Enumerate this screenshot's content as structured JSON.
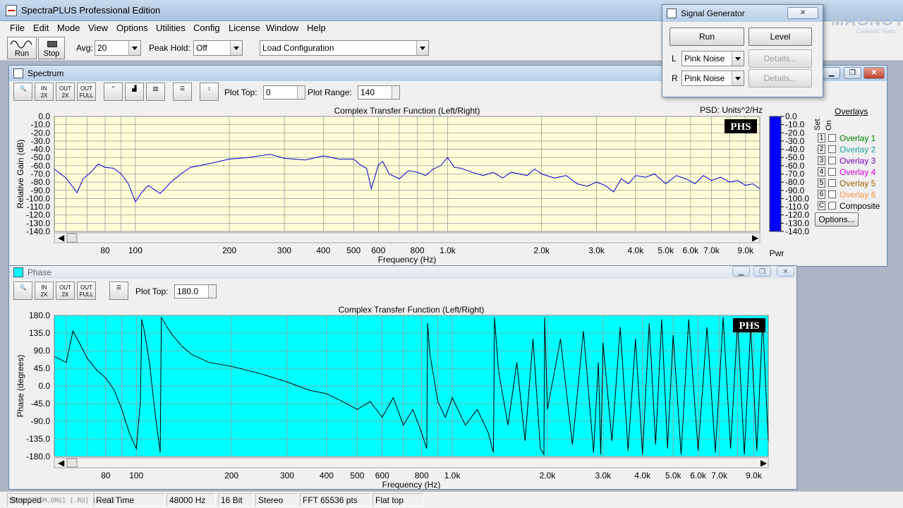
{
  "app": {
    "title": "SpectraPLUS Professional Edition"
  },
  "menu": [
    "File",
    "Edit",
    "Mode",
    "View",
    "Options",
    "Utilities",
    "Config",
    "License",
    "Window",
    "Help"
  ],
  "toolbar": {
    "run_label": "Run",
    "stop_label": "Stop",
    "avg_label": "Avg:",
    "avg_value": "20",
    "peak_label": "Peak Hold:",
    "peak_value": "Off",
    "config_value": "Load Configuration"
  },
  "spectrum": {
    "title": "Spectrum",
    "plot_top_label": "Plot Top:",
    "plot_top_value": "0",
    "plot_range_label": "Plot Range:",
    "plot_range_value": "140",
    "chart_title": "Complex Transfer Function (Left/Right)",
    "psd_label": "PSD: Units^2/Hz",
    "ylabel": "Relative Gain (dB)",
    "xlabel": "Frequency (Hz)",
    "badge": "PHS",
    "pwr_label": "Pwr",
    "overlays_title": "Overlays",
    "set_label": "Set",
    "on_label": "On",
    "overlays": [
      {
        "num": "1",
        "label": "Overlay 1",
        "color": "#008000"
      },
      {
        "num": "2",
        "label": "Overlay 2",
        "color": "#20a0a0"
      },
      {
        "num": "3",
        "label": "Overlay 3",
        "color": "#8000c0"
      },
      {
        "num": "4",
        "label": "Overlay 4",
        "color": "#e000e0"
      },
      {
        "num": "5",
        "label": "Overlay 5",
        "color": "#a06000"
      },
      {
        "num": "6",
        "label": "Overlay 6",
        "color": "#ff9040"
      },
      {
        "num": "C",
        "label": "Composite",
        "color": "#000000"
      }
    ],
    "options_label": "Options..."
  },
  "phase": {
    "title": "Phase",
    "plot_top_label": "Plot Top:",
    "plot_top_value": "180.0",
    "chart_title": "Complex Transfer Function (Left/Right)",
    "ylabel": "Phase (degrees)",
    "xlabel": "Frequency (Hz)",
    "badge": "PHS"
  },
  "siggen": {
    "title": "Signal Generator",
    "run_label": "Run",
    "level_label": "Level",
    "l_label": "L",
    "r_label": "R",
    "l_value": "Pink Noise",
    "r_value": "Pink Noise",
    "details_label": "Details..."
  },
  "watermark": {
    "brand": "MAGNOTA",
    "sub": "CarAudio Team"
  },
  "status": {
    "state": "Stopped",
    "mode": "Real Time",
    "rate": "48000 Hz",
    "bits": "16 Bit",
    "channels": "Stereo",
    "fft": "FFT 65536 pts",
    "window": "Flat top",
    "footer_mark": "[MAGNOTEAM.ORG] [.RU] [.NET]"
  },
  "chart_data": [
    {
      "type": "line",
      "title": "Complex Transfer Function (Left/Right)",
      "xlabel": "Frequency (Hz)",
      "ylabel": "Relative Gain (dB)",
      "x_scale": "log",
      "xlim": [
        55,
        10000
      ],
      "ylim": [
        -140,
        0
      ],
      "y_ticks": [
        "0.0",
        "-10.0",
        "-20.0",
        "-30.0",
        "-40.0",
        "-50.0",
        "-60.0",
        "-70.0",
        "-80.0",
        "-90.0",
        "-100.0",
        "-110.0",
        "-120.0",
        "-130.0",
        "-140.0"
      ],
      "x_ticks": [
        {
          "v": 80,
          "l": "80"
        },
        {
          "v": 100,
          "l": "100"
        },
        {
          "v": 200,
          "l": "200"
        },
        {
          "v": 300,
          "l": "300"
        },
        {
          "v": 400,
          "l": "400"
        },
        {
          "v": 500,
          "l": "500"
        },
        {
          "v": 600,
          "l": "600"
        },
        {
          "v": 800,
          "l": "800"
        },
        {
          "v": 1000,
          "l": "1.0k"
        },
        {
          "v": 2000,
          "l": "2.0k"
        },
        {
          "v": 3000,
          "l": "3.0k"
        },
        {
          "v": 4000,
          "l": "4.0k"
        },
        {
          "v": 5000,
          "l": "5.0k"
        },
        {
          "v": 6000,
          "l": "6.0k"
        },
        {
          "v": 7000,
          "l": "7.0k"
        },
        {
          "v": 9000,
          "l": "9.0k"
        }
      ],
      "grid": true,
      "series": [
        {
          "color": "#0000cc",
          "x": [
            55,
            60,
            65,
            68,
            72,
            76,
            80,
            85,
            90,
            95,
            100,
            105,
            110,
            120,
            130,
            140,
            150,
            170,
            200,
            230,
            270,
            300,
            350,
            400,
            450,
            500,
            530,
            550,
            570,
            600,
            620,
            650,
            700,
            750,
            800,
            850,
            900,
            950,
            1000,
            1050,
            1100,
            1200,
            1300,
            1400,
            1500,
            1600,
            1700,
            1800,
            1900,
            2000,
            2200,
            2400,
            2600,
            2800,
            3000,
            3200,
            3400,
            3600,
            3800,
            4000,
            4300,
            4600,
            5000,
            5400,
            5800,
            6200,
            6600,
            7000,
            7500,
            8000,
            8500,
            9000,
            9500,
            10000
          ],
          "y": [
            -64,
            -75,
            -93,
            -76,
            -68,
            -58,
            -62,
            -63,
            -70,
            -82,
            -104,
            -92,
            -84,
            -94,
            -80,
            -70,
            -62,
            -58,
            -52,
            -50,
            -46,
            -51,
            -53,
            -48,
            -52,
            -52,
            -60,
            -63,
            -88,
            -59,
            -55,
            -70,
            -76,
            -66,
            -68,
            -72,
            -64,
            -60,
            -50,
            -62,
            -63,
            -68,
            -72,
            -68,
            -75,
            -68,
            -70,
            -72,
            -64,
            -70,
            -75,
            -72,
            -82,
            -85,
            -80,
            -84,
            -92,
            -76,
            -82,
            -72,
            -74,
            -70,
            -82,
            -72,
            -76,
            -82,
            -72,
            -78,
            -74,
            -80,
            -78,
            -84,
            -82,
            -88
          ]
        }
      ]
    },
    {
      "type": "line",
      "title": "Complex Transfer Function (Left/Right)",
      "xlabel": "Frequency (Hz)",
      "ylabel": "Phase (degrees)",
      "x_scale": "log",
      "xlim": [
        55,
        10000
      ],
      "ylim": [
        -180,
        180
      ],
      "y_ticks": [
        "180.0",
        "135.0",
        "90.0",
        "45.0",
        "0.0",
        "-45.0",
        "-90.0",
        "-135.0",
        "-180.0"
      ],
      "x_ticks": [
        {
          "v": 80,
          "l": "80"
        },
        {
          "v": 100,
          "l": "100"
        },
        {
          "v": 200,
          "l": "200"
        },
        {
          "v": 300,
          "l": "300"
        },
        {
          "v": 400,
          "l": "400"
        },
        {
          "v": 500,
          "l": "500"
        },
        {
          "v": 600,
          "l": "600"
        },
        {
          "v": 800,
          "l": "800"
        },
        {
          "v": 1000,
          "l": "1.0k"
        },
        {
          "v": 2000,
          "l": "2.0k"
        },
        {
          "v": 3000,
          "l": "3.0k"
        },
        {
          "v": 4000,
          "l": "4.0k"
        },
        {
          "v": 5000,
          "l": "5.0k"
        },
        {
          "v": 6000,
          "l": "6.0k"
        },
        {
          "v": 7000,
          "l": "7.0k"
        },
        {
          "v": 9000,
          "l": "9.0k"
        }
      ],
      "grid": true,
      "series": [
        {
          "color": "#000000",
          "x": [
            55,
            60,
            63,
            66,
            70,
            75,
            80,
            85,
            90,
            95,
            100,
            103,
            104,
            106,
            110,
            115,
            119,
            120,
            125,
            130,
            140,
            150,
            170,
            200,
            250,
            300,
            350,
            400,
            450,
            500,
            550,
            600,
            650,
            700,
            750,
            800,
            830,
            835,
            850,
            900,
            950,
            1000,
            1100,
            1200,
            1300,
            1350,
            1360,
            1400,
            1500,
            1600,
            1700,
            1800,
            1900,
            1950,
            1960,
            2000,
            2200,
            2400,
            2600,
            2800,
            2900,
            2950,
            3000,
            3200,
            3400,
            3600,
            3800,
            4000,
            4200,
            4400,
            4600,
            4800,
            5000,
            5300,
            5600,
            6000,
            6400,
            6800,
            7200,
            7600,
            8000,
            8400,
            8800,
            9200,
            9600,
            10000
          ],
          "y": [
            75,
            60,
            140,
            110,
            70,
            40,
            20,
            -10,
            -60,
            -120,
            -160,
            -40,
            170,
            140,
            60,
            -80,
            -170,
            175,
            150,
            130,
            100,
            80,
            60,
            50,
            30,
            10,
            -10,
            -20,
            -40,
            -60,
            -40,
            -80,
            -30,
            -100,
            -60,
            -120,
            -160,
            160,
            80,
            -40,
            -80,
            -30,
            -100,
            -60,
            -120,
            -170,
            175,
            40,
            -100,
            60,
            -140,
            120,
            -160,
            -175,
            175,
            -60,
            120,
            -150,
            140,
            -170,
            60,
            -175,
            110,
            -140,
            150,
            -165,
            120,
            -175,
            160,
            -150,
            170,
            -160,
            130,
            -175,
            170,
            -165,
            150,
            -170,
            175,
            -160,
            165,
            -175,
            150,
            -165,
            170,
            -140
          ]
        }
      ]
    }
  ]
}
